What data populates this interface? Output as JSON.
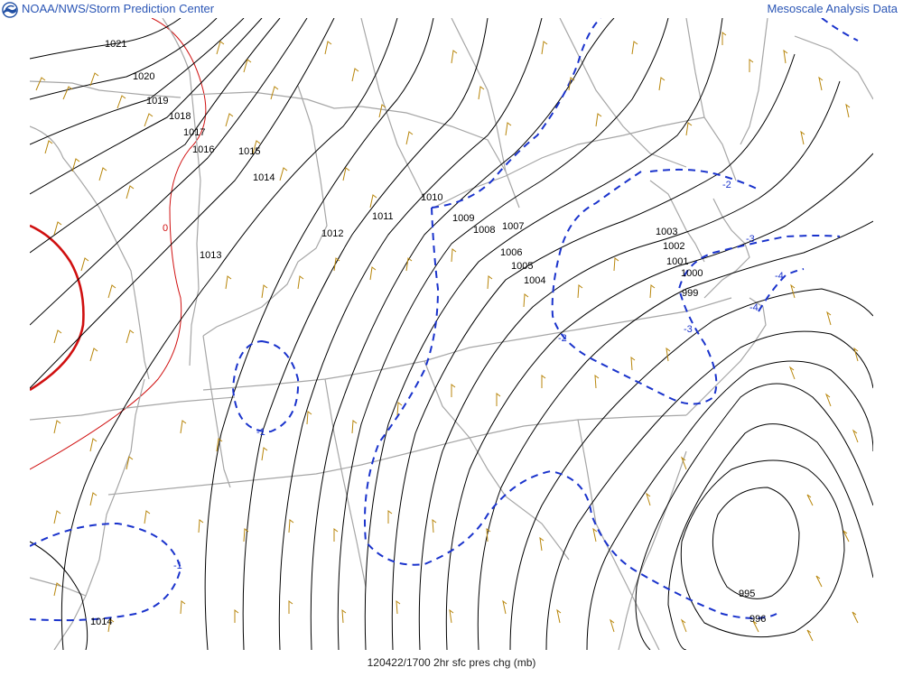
{
  "header": {
    "org_title": "NOAA/NWS/Storm Prediction Center",
    "product_title": "Mesoscale Analysis Data"
  },
  "footer": {
    "caption": "120422/1700 2hr sfc pres chg (mb)"
  },
  "colors": {
    "isobar": "#000000",
    "pressure_change_negative": "#1a33cc",
    "pressure_change_zero": "#d01010",
    "pressure_change_positive_fill": "#cc1111",
    "wind_barb": "#b8860b",
    "borders": "#a0a0a0",
    "title_text": "#2a55b5"
  },
  "map": {
    "isobar_labels": [
      "1021",
      "1020",
      "1019",
      "1018",
      "1017",
      "1016",
      "1015",
      "1014",
      "1013",
      "1012",
      "1011",
      "1010",
      "1009",
      "1008",
      "1007",
      "1006",
      "1005",
      "1004",
      "1003",
      "1002",
      "1001",
      "1000",
      "999",
      "995",
      "996",
      "1014"
    ],
    "pressure_change_labels": [
      "-1",
      "-1",
      "-2",
      "-2",
      "-3",
      "-3",
      "-4",
      "-4"
    ],
    "zero_label": "0"
  }
}
